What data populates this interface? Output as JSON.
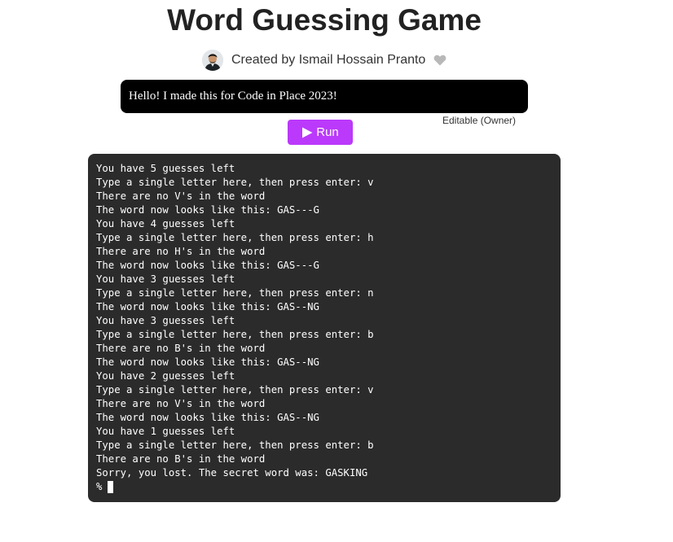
{
  "page": {
    "title": "Word Guessing Game",
    "author_credit": "Created by Ismail Hossain Pranto",
    "description": "Hello! I made this for Code in Place 2023!",
    "edit_status": "Editable (Owner)",
    "run_label": "Run",
    "icons": {
      "avatar": "author-avatar",
      "favorite": "heart-icon",
      "run": "play-icon"
    },
    "colors": {
      "run_button": "#bb39fb",
      "terminal_background": "#2b2b2b",
      "description_background": "#000000",
      "heart": "#b8b8b8"
    }
  },
  "terminal": {
    "lines": [
      "You have 5 guesses left",
      "Type a single letter here, then press enter: v",
      "There are no V's in the word",
      "The word now looks like this: GAS---G",
      "You have 4 guesses left",
      "Type a single letter here, then press enter: h",
      "There are no H's in the word",
      "The word now looks like this: GAS---G",
      "You have 3 guesses left",
      "Type a single letter here, then press enter: n",
      "The word now looks like this: GAS--NG",
      "You have 3 guesses left",
      "Type a single letter here, then press enter: b",
      "There are no B's in the word",
      "The word now looks like this: GAS--NG",
      "You have 2 guesses left",
      "Type a single letter here, then press enter: v",
      "There are no V's in the word",
      "The word now looks like this: GAS--NG",
      "You have 1 guesses left",
      "Type a single letter here, then press enter: b",
      "There are no B's in the word",
      "Sorry, you lost. The secret word was: GASKING"
    ],
    "prompt": "%"
  }
}
